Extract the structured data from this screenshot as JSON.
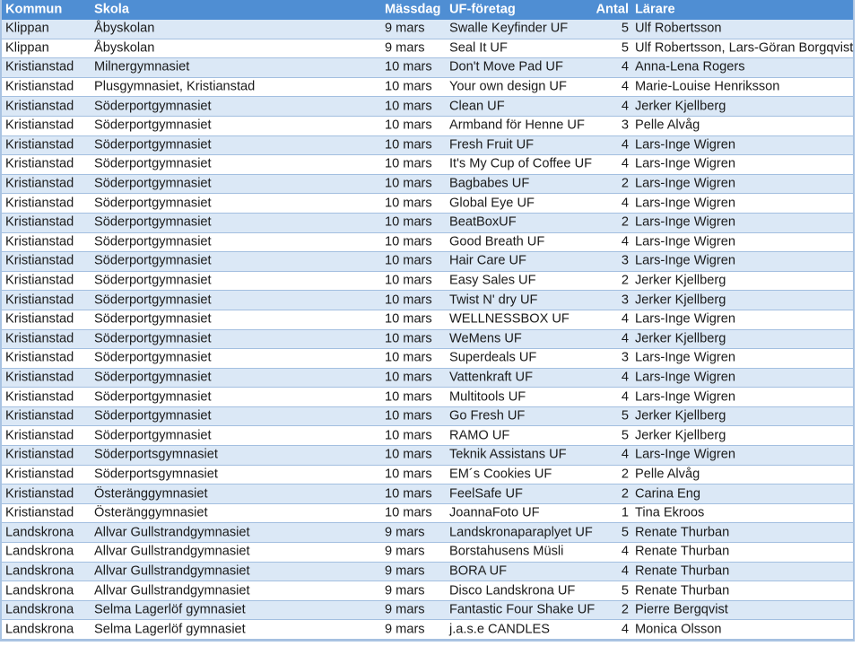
{
  "header": {
    "kommun": "Kommun",
    "skola": "Skola",
    "massdag": "Mässdag",
    "uf_foretag": "UF-företag",
    "antal": "Antal",
    "larare": "Lärare"
  },
  "colors": {
    "header_bg": "#4f8ed3",
    "stripe_bg": "#dbe8f6",
    "border": "#a3bfe0"
  },
  "rows": [
    {
      "kommun": "Klippan",
      "skola": "Åbyskolan",
      "massdag": "9 mars",
      "uf": "Swalle Keyfinder UF",
      "antal": "5",
      "larare": "Ulf Robertsson"
    },
    {
      "kommun": "Klippan",
      "skola": "Åbyskolan",
      "massdag": "9 mars",
      "uf": "Seal It UF",
      "antal": "5",
      "larare": "Ulf Robertsson, Lars-Göran Borgqvist"
    },
    {
      "kommun": "Kristianstad",
      "skola": "Milnergymnasiet",
      "massdag": "10 mars",
      "uf": "Don't Move Pad UF",
      "antal": "4",
      "larare": "Anna-Lena Rogers"
    },
    {
      "kommun": "Kristianstad",
      "skola": "Plusgymnasiet, Kristianstad",
      "massdag": "10 mars",
      "uf": "Your own design UF",
      "antal": "4",
      "larare": "Marie-Louise Henriksson"
    },
    {
      "kommun": "Kristianstad",
      "skola": "Söderportgymnasiet",
      "massdag": "10 mars",
      "uf": "Clean UF",
      "antal": "4",
      "larare": "Jerker Kjellberg"
    },
    {
      "kommun": "Kristianstad",
      "skola": "Söderportgymnasiet",
      "massdag": "10 mars",
      "uf": "Armband för Henne UF",
      "antal": "3",
      "larare": "Pelle Alvåg"
    },
    {
      "kommun": "Kristianstad",
      "skola": "Söderportgymnasiet",
      "massdag": "10 mars",
      "uf": "Fresh Fruit UF",
      "antal": "4",
      "larare": "Lars-Inge Wigren"
    },
    {
      "kommun": "Kristianstad",
      "skola": "Söderportgymnasiet",
      "massdag": "10 mars",
      "uf": "It's My Cup of Coffee UF",
      "antal": "4",
      "larare": "Lars-Inge Wigren"
    },
    {
      "kommun": "Kristianstad",
      "skola": "Söderportgymnasiet",
      "massdag": "10 mars",
      "uf": "Bagbabes UF",
      "antal": "2",
      "larare": "Lars-Inge Wigren"
    },
    {
      "kommun": "Kristianstad",
      "skola": "Söderportgymnasiet",
      "massdag": "10 mars",
      "uf": "Global Eye UF",
      "antal": "4",
      "larare": "Lars-Inge Wigren"
    },
    {
      "kommun": "Kristianstad",
      "skola": "Söderportgymnasiet",
      "massdag": "10 mars",
      "uf": "BeatBoxUF",
      "antal": "2",
      "larare": "Lars-Inge Wigren"
    },
    {
      "kommun": "Kristianstad",
      "skola": "Söderportgymnasiet",
      "massdag": "10 mars",
      "uf": "Good Breath UF",
      "antal": "4",
      "larare": "Lars-Inge Wigren"
    },
    {
      "kommun": "Kristianstad",
      "skola": "Söderportgymnasiet",
      "massdag": "10 mars",
      "uf": "Hair Care UF",
      "antal": "3",
      "larare": "Lars-Inge Wigren"
    },
    {
      "kommun": "Kristianstad",
      "skola": "Söderportgymnasiet",
      "massdag": "10 mars",
      "uf": "Easy Sales UF",
      "antal": "2",
      "larare": "Jerker Kjellberg"
    },
    {
      "kommun": "Kristianstad",
      "skola": "Söderportgymnasiet",
      "massdag": "10 mars",
      "uf": "Twist N' dry UF",
      "antal": "3",
      "larare": "Jerker Kjellberg"
    },
    {
      "kommun": "Kristianstad",
      "skola": "Söderportgymnasiet",
      "massdag": "10 mars",
      "uf": "WELLNESSBOX UF",
      "antal": "4",
      "larare": "Lars-Inge Wigren"
    },
    {
      "kommun": "Kristianstad",
      "skola": "Söderportgymnasiet",
      "massdag": "10 mars",
      "uf": "WeMens UF",
      "antal": "4",
      "larare": "Jerker Kjellberg"
    },
    {
      "kommun": "Kristianstad",
      "skola": "Söderportgymnasiet",
      "massdag": "10 mars",
      "uf": "Superdeals UF",
      "antal": "3",
      "larare": "Lars-Inge Wigren"
    },
    {
      "kommun": "Kristianstad",
      "skola": "Söderportgymnasiet",
      "massdag": "10 mars",
      "uf": "Vattenkraft UF",
      "antal": "4",
      "larare": "Lars-Inge Wigren"
    },
    {
      "kommun": "Kristianstad",
      "skola": "Söderportgymnasiet",
      "massdag": "10 mars",
      "uf": "Multitools UF",
      "antal": "4",
      "larare": "Lars-Inge Wigren"
    },
    {
      "kommun": "Kristianstad",
      "skola": "Söderportgymnasiet",
      "massdag": "10 mars",
      "uf": "Go Fresh UF",
      "antal": "5",
      "larare": "Jerker Kjellberg"
    },
    {
      "kommun": "Kristianstad",
      "skola": "Söderportgymnasiet",
      "massdag": "10 mars",
      "uf": "RAMO UF",
      "antal": "5",
      "larare": "Jerker Kjellberg"
    },
    {
      "kommun": "Kristianstad",
      "skola": "Söderportsgymnasiet",
      "massdag": "10 mars",
      "uf": "Teknik Assistans UF",
      "antal": "4",
      "larare": "Lars-Inge Wigren"
    },
    {
      "kommun": "Kristianstad",
      "skola": "Söderportsgymnasiet",
      "massdag": "10 mars",
      "uf": "EM´s Cookies UF",
      "antal": "2",
      "larare": "Pelle Alvåg"
    },
    {
      "kommun": "Kristianstad",
      "skola": "Österänggymnasiet",
      "massdag": "10 mars",
      "uf": "FeelSafe UF",
      "antal": "2",
      "larare": "Carina Eng"
    },
    {
      "kommun": "Kristianstad",
      "skola": "Österänggymnasiet",
      "massdag": "10 mars",
      "uf": "JoannaFoto UF",
      "antal": "1",
      "larare": "Tina Ekroos"
    },
    {
      "kommun": "Landskrona",
      "skola": "Allvar Gullstrandgymnasiet",
      "massdag": "9 mars",
      "uf": "Landskronaparaplyet UF",
      "antal": "5",
      "larare": "Renate Thurban"
    },
    {
      "kommun": "Landskrona",
      "skola": "Allvar Gullstrandgymnasiet",
      "massdag": "9 mars",
      "uf": "Borstahusens Müsli",
      "antal": "4",
      "larare": "Renate Thurban"
    },
    {
      "kommun": "Landskrona",
      "skola": "Allvar Gullstrandgymnasiet",
      "massdag": "9 mars",
      "uf": "BORA UF",
      "antal": "4",
      "larare": "Renate Thurban"
    },
    {
      "kommun": "Landskrona",
      "skola": "Allvar Gullstrandgymnasiet",
      "massdag": "9 mars",
      "uf": "Disco Landskrona UF",
      "antal": "5",
      "larare": "Renate Thurban"
    },
    {
      "kommun": "Landskrona",
      "skola": "Selma Lagerlöf gymnasiet",
      "massdag": "9 mars",
      "uf": "Fantastic Four Shake UF",
      "antal": "2",
      "larare": "Pierre Bergqvist"
    },
    {
      "kommun": "Landskrona",
      "skola": "Selma Lagerlöf gymnasiet",
      "massdag": "9 mars",
      "uf": "j.a.s.e CANDLES",
      "antal": "4",
      "larare": "Monica Olsson"
    }
  ]
}
